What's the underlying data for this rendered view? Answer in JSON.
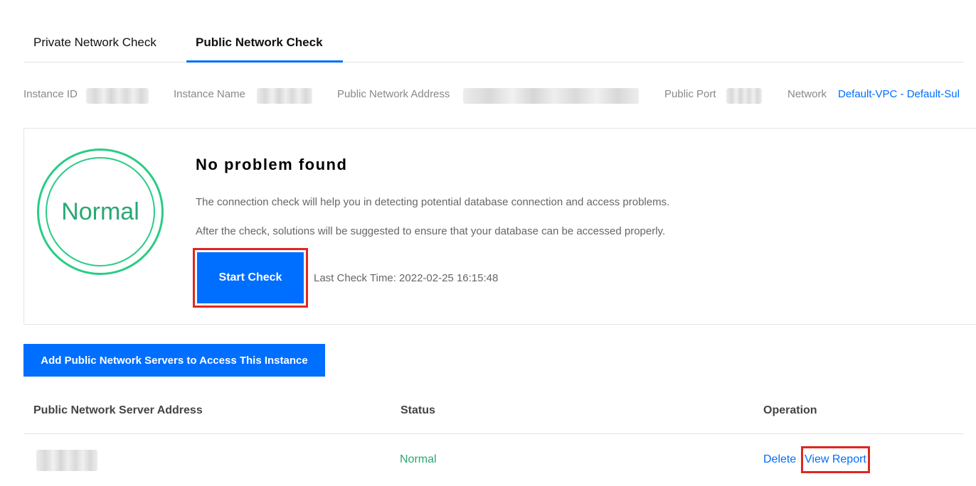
{
  "tabs": [
    {
      "label": "Private Network Check",
      "active": false
    },
    {
      "label": "Public Network Check",
      "active": true
    }
  ],
  "info": {
    "instance_id_label": "Instance ID",
    "instance_name_label": "Instance Name",
    "public_address_label": "Public Network Address",
    "public_port_label": "Public Port",
    "network_label": "Network",
    "network_value": "Default-VPC - Default-Sul"
  },
  "check": {
    "status_ring_text": "Normal",
    "title": "No problem found",
    "desc_line1": "The connection check will help you in detecting potential database connection and access problems.",
    "desc_line2": "After the check, solutions will be suggested to ensure that your database can be accessed properly.",
    "start_button": "Start Check",
    "last_check": "Last Check Time: 2022-02-25 16:15:48"
  },
  "add_button": "Add Public Network Servers to Access This Instance",
  "table": {
    "columns": [
      "Public Network Server Address",
      "Status",
      "Operation"
    ],
    "rows": [
      {
        "status": "Normal",
        "actions": [
          "Delete",
          "View Report"
        ]
      }
    ]
  },
  "colors": {
    "accent": "#006eff",
    "normal_green": "#29cc85",
    "highlight_red": "#e0271f"
  }
}
